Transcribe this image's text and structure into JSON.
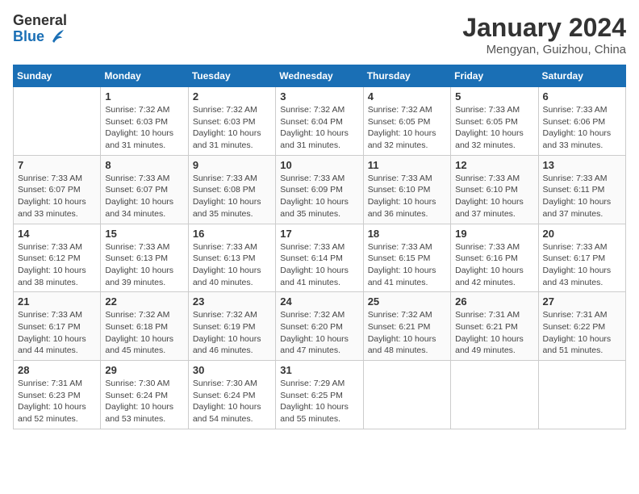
{
  "header": {
    "logo_line1": "General",
    "logo_line2": "Blue",
    "month": "January 2024",
    "location": "Mengyan, Guizhou, China"
  },
  "days_of_week": [
    "Sunday",
    "Monday",
    "Tuesday",
    "Wednesday",
    "Thursday",
    "Friday",
    "Saturday"
  ],
  "weeks": [
    [
      {
        "day": "",
        "sunrise": "",
        "sunset": "",
        "daylight": ""
      },
      {
        "day": "1",
        "sunrise": "Sunrise: 7:32 AM",
        "sunset": "Sunset: 6:03 PM",
        "daylight": "Daylight: 10 hours and 31 minutes."
      },
      {
        "day": "2",
        "sunrise": "Sunrise: 7:32 AM",
        "sunset": "Sunset: 6:03 PM",
        "daylight": "Daylight: 10 hours and 31 minutes."
      },
      {
        "day": "3",
        "sunrise": "Sunrise: 7:32 AM",
        "sunset": "Sunset: 6:04 PM",
        "daylight": "Daylight: 10 hours and 31 minutes."
      },
      {
        "day": "4",
        "sunrise": "Sunrise: 7:32 AM",
        "sunset": "Sunset: 6:05 PM",
        "daylight": "Daylight: 10 hours and 32 minutes."
      },
      {
        "day": "5",
        "sunrise": "Sunrise: 7:33 AM",
        "sunset": "Sunset: 6:05 PM",
        "daylight": "Daylight: 10 hours and 32 minutes."
      },
      {
        "day": "6",
        "sunrise": "Sunrise: 7:33 AM",
        "sunset": "Sunset: 6:06 PM",
        "daylight": "Daylight: 10 hours and 33 minutes."
      }
    ],
    [
      {
        "day": "7",
        "sunrise": "Sunrise: 7:33 AM",
        "sunset": "Sunset: 6:07 PM",
        "daylight": "Daylight: 10 hours and 33 minutes."
      },
      {
        "day": "8",
        "sunrise": "Sunrise: 7:33 AM",
        "sunset": "Sunset: 6:07 PM",
        "daylight": "Daylight: 10 hours and 34 minutes."
      },
      {
        "day": "9",
        "sunrise": "Sunrise: 7:33 AM",
        "sunset": "Sunset: 6:08 PM",
        "daylight": "Daylight: 10 hours and 35 minutes."
      },
      {
        "day": "10",
        "sunrise": "Sunrise: 7:33 AM",
        "sunset": "Sunset: 6:09 PM",
        "daylight": "Daylight: 10 hours and 35 minutes."
      },
      {
        "day": "11",
        "sunrise": "Sunrise: 7:33 AM",
        "sunset": "Sunset: 6:10 PM",
        "daylight": "Daylight: 10 hours and 36 minutes."
      },
      {
        "day": "12",
        "sunrise": "Sunrise: 7:33 AM",
        "sunset": "Sunset: 6:10 PM",
        "daylight": "Daylight: 10 hours and 37 minutes."
      },
      {
        "day": "13",
        "sunrise": "Sunrise: 7:33 AM",
        "sunset": "Sunset: 6:11 PM",
        "daylight": "Daylight: 10 hours and 37 minutes."
      }
    ],
    [
      {
        "day": "14",
        "sunrise": "Sunrise: 7:33 AM",
        "sunset": "Sunset: 6:12 PM",
        "daylight": "Daylight: 10 hours and 38 minutes."
      },
      {
        "day": "15",
        "sunrise": "Sunrise: 7:33 AM",
        "sunset": "Sunset: 6:13 PM",
        "daylight": "Daylight: 10 hours and 39 minutes."
      },
      {
        "day": "16",
        "sunrise": "Sunrise: 7:33 AM",
        "sunset": "Sunset: 6:13 PM",
        "daylight": "Daylight: 10 hours and 40 minutes."
      },
      {
        "day": "17",
        "sunrise": "Sunrise: 7:33 AM",
        "sunset": "Sunset: 6:14 PM",
        "daylight": "Daylight: 10 hours and 41 minutes."
      },
      {
        "day": "18",
        "sunrise": "Sunrise: 7:33 AM",
        "sunset": "Sunset: 6:15 PM",
        "daylight": "Daylight: 10 hours and 41 minutes."
      },
      {
        "day": "19",
        "sunrise": "Sunrise: 7:33 AM",
        "sunset": "Sunset: 6:16 PM",
        "daylight": "Daylight: 10 hours and 42 minutes."
      },
      {
        "day": "20",
        "sunrise": "Sunrise: 7:33 AM",
        "sunset": "Sunset: 6:17 PM",
        "daylight": "Daylight: 10 hours and 43 minutes."
      }
    ],
    [
      {
        "day": "21",
        "sunrise": "Sunrise: 7:33 AM",
        "sunset": "Sunset: 6:17 PM",
        "daylight": "Daylight: 10 hours and 44 minutes."
      },
      {
        "day": "22",
        "sunrise": "Sunrise: 7:32 AM",
        "sunset": "Sunset: 6:18 PM",
        "daylight": "Daylight: 10 hours and 45 minutes."
      },
      {
        "day": "23",
        "sunrise": "Sunrise: 7:32 AM",
        "sunset": "Sunset: 6:19 PM",
        "daylight": "Daylight: 10 hours and 46 minutes."
      },
      {
        "day": "24",
        "sunrise": "Sunrise: 7:32 AM",
        "sunset": "Sunset: 6:20 PM",
        "daylight": "Daylight: 10 hours and 47 minutes."
      },
      {
        "day": "25",
        "sunrise": "Sunrise: 7:32 AM",
        "sunset": "Sunset: 6:21 PM",
        "daylight": "Daylight: 10 hours and 48 minutes."
      },
      {
        "day": "26",
        "sunrise": "Sunrise: 7:31 AM",
        "sunset": "Sunset: 6:21 PM",
        "daylight": "Daylight: 10 hours and 49 minutes."
      },
      {
        "day": "27",
        "sunrise": "Sunrise: 7:31 AM",
        "sunset": "Sunset: 6:22 PM",
        "daylight": "Daylight: 10 hours and 51 minutes."
      }
    ],
    [
      {
        "day": "28",
        "sunrise": "Sunrise: 7:31 AM",
        "sunset": "Sunset: 6:23 PM",
        "daylight": "Daylight: 10 hours and 52 minutes."
      },
      {
        "day": "29",
        "sunrise": "Sunrise: 7:30 AM",
        "sunset": "Sunset: 6:24 PM",
        "daylight": "Daylight: 10 hours and 53 minutes."
      },
      {
        "day": "30",
        "sunrise": "Sunrise: 7:30 AM",
        "sunset": "Sunset: 6:24 PM",
        "daylight": "Daylight: 10 hours and 54 minutes."
      },
      {
        "day": "31",
        "sunrise": "Sunrise: 7:29 AM",
        "sunset": "Sunset: 6:25 PM",
        "daylight": "Daylight: 10 hours and 55 minutes."
      },
      {
        "day": "",
        "sunrise": "",
        "sunset": "",
        "daylight": ""
      },
      {
        "day": "",
        "sunrise": "",
        "sunset": "",
        "daylight": ""
      },
      {
        "day": "",
        "sunrise": "",
        "sunset": "",
        "daylight": ""
      }
    ]
  ]
}
